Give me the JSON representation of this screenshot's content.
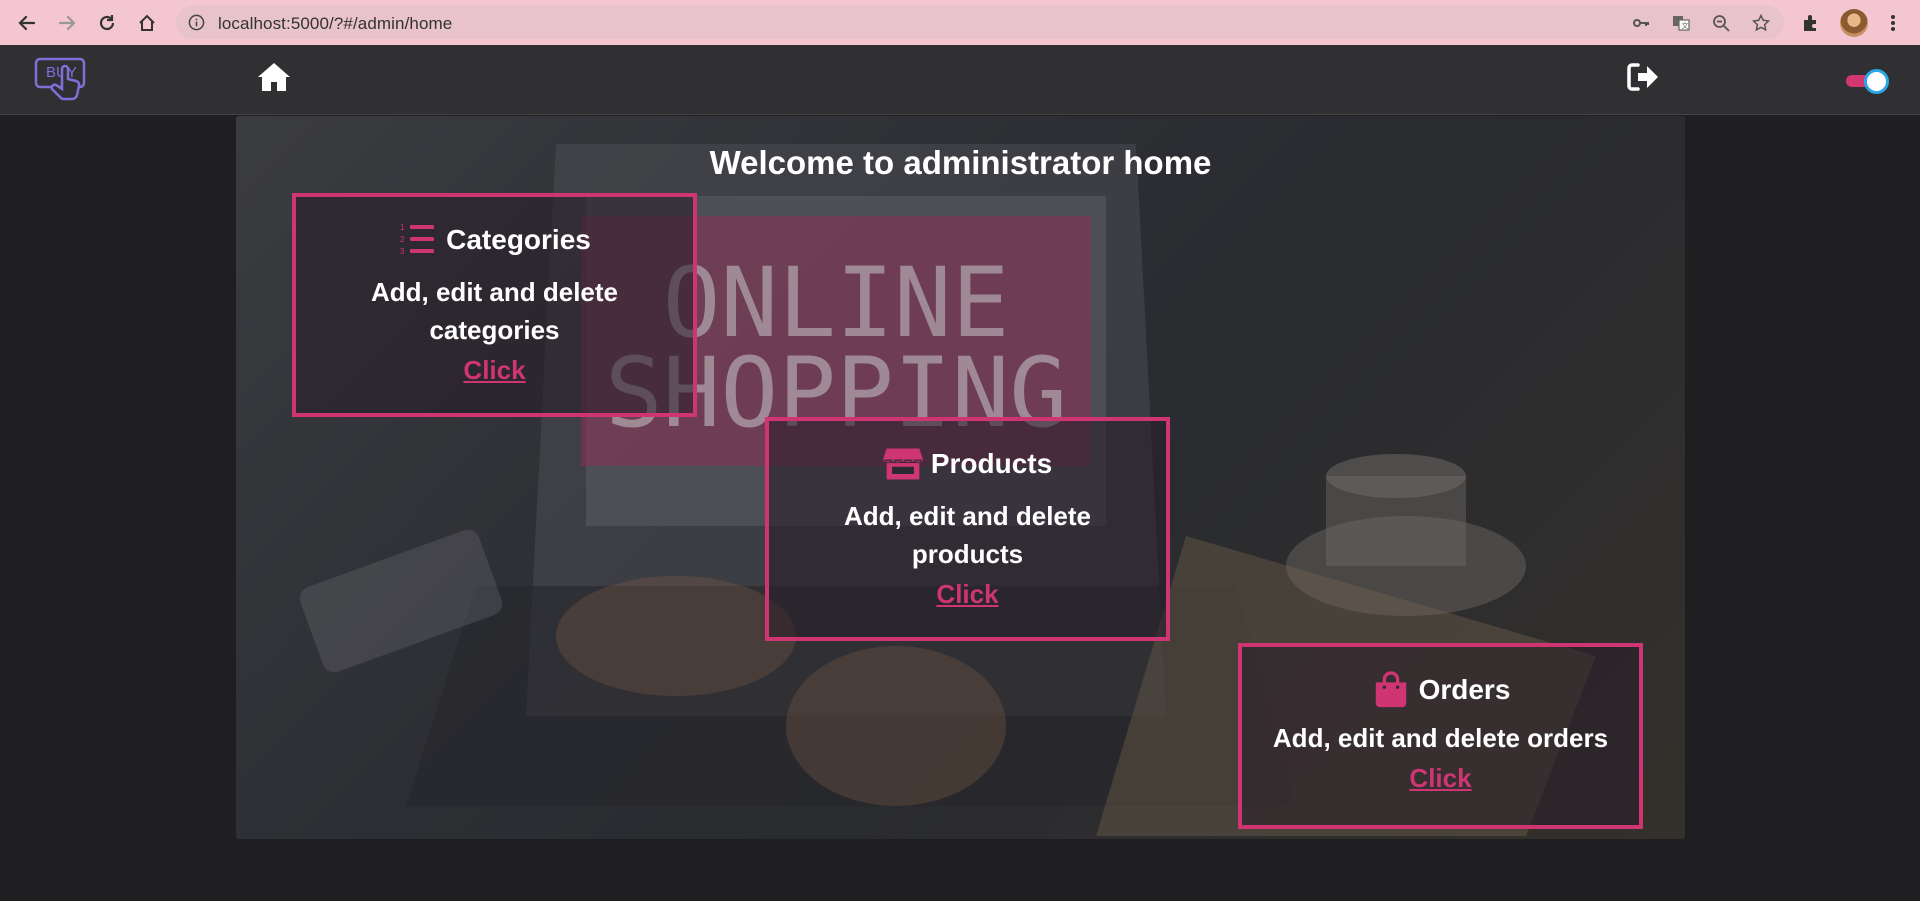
{
  "browser": {
    "url": "localhost:5000/?#/admin/home"
  },
  "app": {
    "logo_text": "BUY",
    "theme_toggle_on": true
  },
  "hero": {
    "title": "Welcome to administrator home",
    "background_text": [
      "ONLINE",
      "SHOPPING"
    ]
  },
  "cards": [
    {
      "title": "Categories",
      "description": "Add, edit and delete categories",
      "link": "Click",
      "icon": "list-ol-icon"
    },
    {
      "title": "Products",
      "description": "Add, edit and delete products",
      "link": "Click",
      "icon": "store-icon"
    },
    {
      "title": "Orders",
      "description": "Add, edit and delete orders",
      "link": "Click",
      "icon": "shopping-bag-icon"
    }
  ],
  "colors": {
    "accent": "#cf3573",
    "browser_bar": "#f3c6d2",
    "navbar": "#303032",
    "page_bg": "#1f1f21"
  }
}
